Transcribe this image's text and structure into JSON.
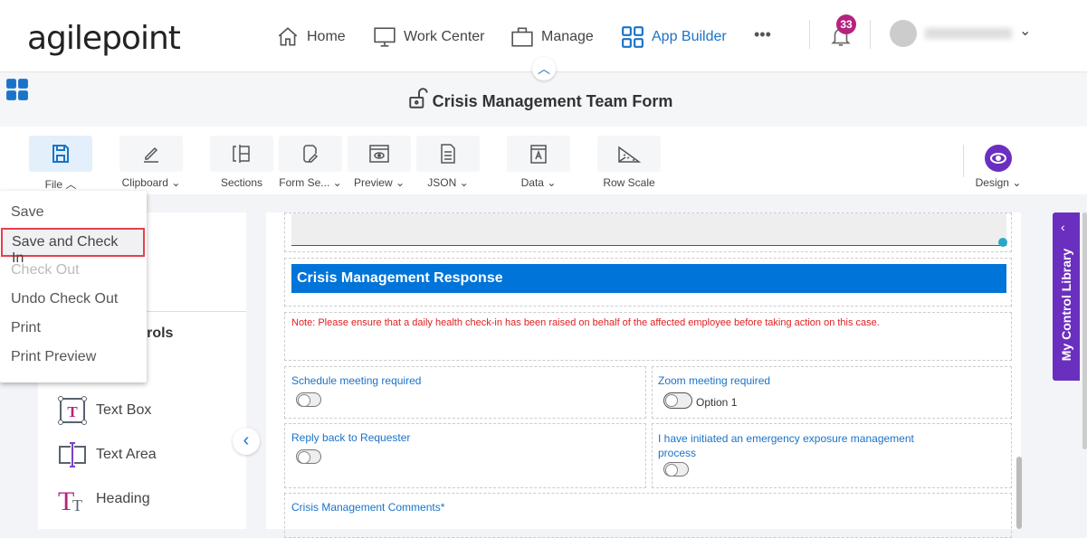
{
  "brand": "agilepoint",
  "nav": {
    "home": "Home",
    "work_center": "Work Center",
    "manage": "Manage",
    "app_builder": "App Builder",
    "more": "•••",
    "notifications": "33"
  },
  "title": "Crisis Management Team Form",
  "toolbar": {
    "file": "File",
    "clipboard": "Clipboard",
    "sections": "Sections",
    "form_settings": "Form Se...",
    "preview": "Preview",
    "json": "JSON",
    "data": "Data",
    "row_scale": "Row Scale",
    "design": "Design"
  },
  "file_menu": [
    "Save",
    "Save and Check In",
    "Check Out",
    "Undo Check Out",
    "Print",
    "Print Preview"
  ],
  "left_panel": {
    "section_title": "ntrols",
    "controls": [
      "Text Box",
      "Text Area",
      "Heading"
    ]
  },
  "form": {
    "section_header": "Crisis Management Response",
    "note": "Note: Please ensure that a daily health check-in has been raised on behalf of the affected employee before taking action on this case.",
    "fields": {
      "schedule": "Schedule meeting required",
      "zoom": "Zoom meeting required",
      "zoom_option": "Option 1",
      "reply": "Reply back to Requester",
      "exposure": "I have initiated an emergency exposure management process",
      "comments": "Crisis Management Comments*"
    }
  },
  "control_library": "My Control Library",
  "colors": {
    "accent": "#1a73c8",
    "header": "#0074d9",
    "note": "#e02020",
    "library": "#6b2fbf",
    "badge": "#b5237f",
    "highlight": "#e8404a"
  }
}
